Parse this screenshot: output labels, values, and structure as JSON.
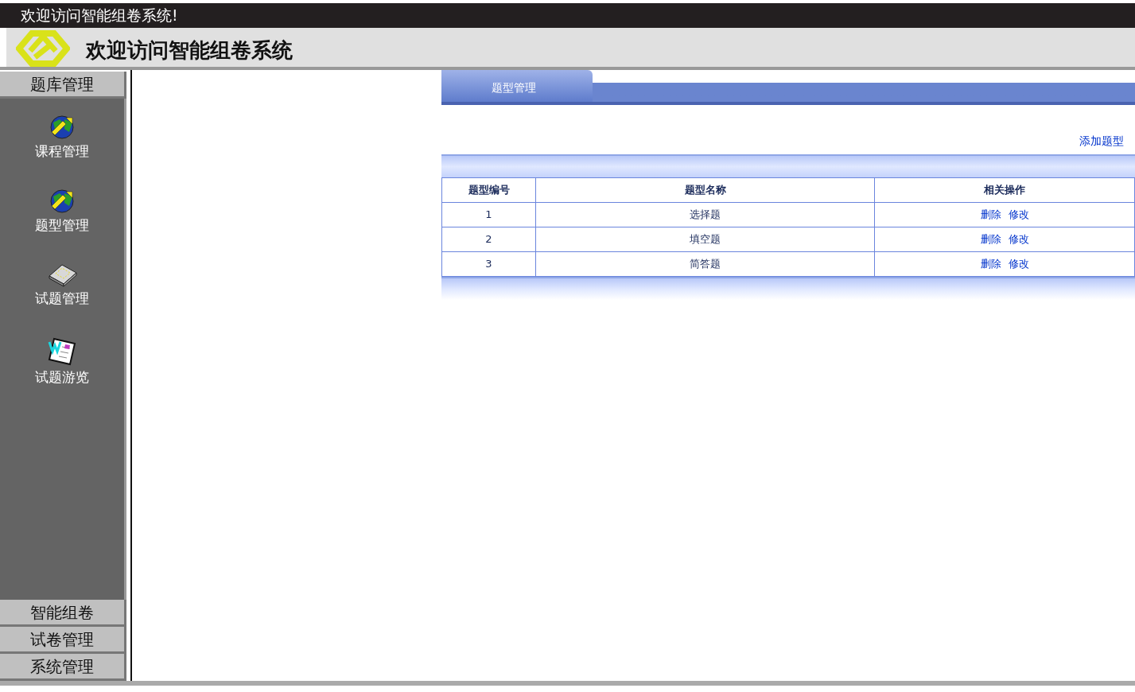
{
  "top_bar": {
    "title": "欢迎访问智能组卷系统!"
  },
  "header": {
    "title": "欢迎访问智能组卷系统"
  },
  "sidebar": {
    "sections": [
      {
        "label": "题库管理",
        "items": [
          {
            "label": "课程管理"
          },
          {
            "label": "题型管理"
          },
          {
            "label": "试题管理"
          },
          {
            "label": "试题游览"
          }
        ]
      },
      {
        "label": "智能组卷"
      },
      {
        "label": "试卷管理"
      },
      {
        "label": "系统管理"
      }
    ]
  },
  "content": {
    "tab": {
      "label": "题型管理"
    },
    "add_link": "添加题型",
    "table": {
      "columns": [
        "题型编号",
        "题型名称",
        "相关操作"
      ],
      "rows": [
        {
          "cells": [
            "1",
            "选择题"
          ],
          "actions": [
            "删除",
            "修改"
          ]
        },
        {
          "cells": [
            "2",
            "填空题"
          ],
          "actions": [
            "删除",
            "修改"
          ]
        },
        {
          "cells": [
            "3",
            "简答题"
          ],
          "actions": [
            "删除",
            "修改"
          ]
        }
      ]
    }
  }
}
